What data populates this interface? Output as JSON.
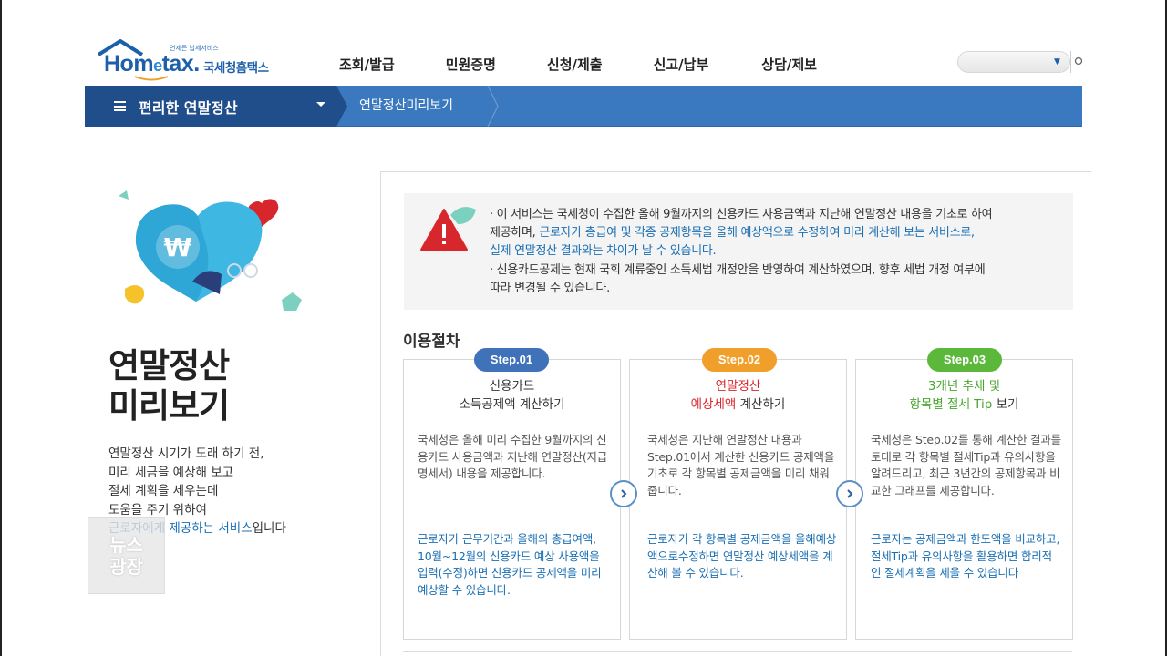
{
  "header": {
    "logo_brand_main": "Hom",
    "logo_brand_e": "e",
    "logo_brand_tail": "tax",
    "logo_brand_kr": "국세청홈택스",
    "logo_tagline": "언제든 납세서비스",
    "gnb": [
      "조회/발급",
      "민원증명",
      "신청/제출",
      "신고/납부",
      "상담/제보"
    ],
    "search_placeholder": ""
  },
  "navbar": {
    "menu_label": "편리한 연말정산",
    "breadcrumb": "연말정산미리보기"
  },
  "promo": {
    "title_line1": "연말정산",
    "title_line2": "미리보기",
    "desc_lines": [
      "연말정산 시기가 도래 하기 전,",
      "미리 세금을 예상해 보고",
      "절세 계획을 세우는데",
      "도움을 주기 위하여"
    ],
    "desc_hl": "근로자에게 제공하는 서비스",
    "desc_tail": "입니다",
    "currency_symbol": "₩",
    "watermark_lines": [
      "뉴스",
      "광장"
    ]
  },
  "notice": {
    "b1_start": "· 이 서비스는 국세청이 수집한 올해 9월까지의 신용카드 사용금액과 지난해 연말정산 내용을 기초로 하여",
    "b1_mid": "제공하며, ",
    "b1_blue1": "근로자가 총급여 및 각종 공제항목을 올해 예상액으로 수정하여 미리 계산해 보는 서비스로,",
    "b1_blue2": "실제 연말정산 결과와는 차이가 날 수 있습니다.",
    "b2_line1": "· 신용카드공제는 현재 국회 계류중인 소득세법 개정안을 반영하여 계산하였으며, 향후 세법 개정 여부에",
    "b2_line2": "따라 변경될 수 있습니다."
  },
  "procedure": {
    "title": "이용절차",
    "steps": [
      {
        "badge": "Step.01",
        "color": "#3f72b8",
        "head1": "신용카드",
        "head2": "소득공제액 계산하기",
        "body": "국세청은 올해 미리 수집한 9월까지의 신용카드 사용금액과 지난해 연말정산(지급명세서) 내용을 제공합니다.",
        "blue": "근로자가 근무기간과 올해의 총급여액, 10월~12월의 신용카드 예상 사용액을 입력(수정)하면 신용카드 공제액을 미리 예상할 수 있습니다."
      },
      {
        "badge": "Step.02",
        "color": "#f0a02a",
        "head1": "연말정산",
        "head2_red": "예상세액",
        "head2_tail": " 계산하기",
        "body": "국세청은 지난해 연말정산 내용과 Step.01에서 계산한 신용카드 공제액을 기초로 각 항목별 공제금액을 미리 채워줍니다.",
        "blue": "근로자가 각 항목별 공제금액을 올해예상액으로수정하면 연말정산 예상세액을 계산해 볼 수 있습니다."
      },
      {
        "badge": "Step.03",
        "color": "#5cb83a",
        "head1": "3개년 추세 및",
        "head2_green": "항목별 절세 Tip",
        "head2_tail": " 보기",
        "body": "국세청은 Step.02를 통해 계산한 결과를 토대로 각 항목별 절세Tip과 유의사항을 알려드리고, 최근 3년간의 공제항목과 비교한 그래프를 제공합니다.",
        "blue": "근로자는 공제금액과 한도액을 비교하고, 절세Tip과 유의사항을 활용하면 합리적인 절세계획을 세울 수 있습니다"
      }
    ]
  }
}
